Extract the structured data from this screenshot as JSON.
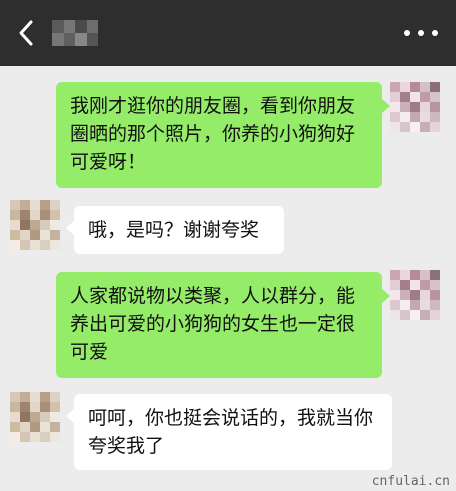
{
  "header": {
    "back_icon": "chevron-left-icon",
    "more_icon": "more-dots-icon"
  },
  "messages": [
    {
      "sender": "me",
      "text": "我刚才逛你的朋友圈，看到你朋友圈晒的那个照片，你养的小狗狗好可爱呀！"
    },
    {
      "sender": "other",
      "text": "哦，是吗？谢谢夸奖"
    },
    {
      "sender": "me",
      "text": "人家都说物以类聚，人以群分，能养出可爱的小狗狗的女生也一定很可爱"
    },
    {
      "sender": "other",
      "text": "呵呵，你也挺会说话的，我就当你夸奖我了"
    }
  ],
  "watermark": "cnfulai.cn",
  "colors": {
    "header_bg": "#2e2e2e",
    "chat_bg": "#ececec",
    "my_bubble": "#95ec69",
    "other_bubble": "#ffffff"
  }
}
